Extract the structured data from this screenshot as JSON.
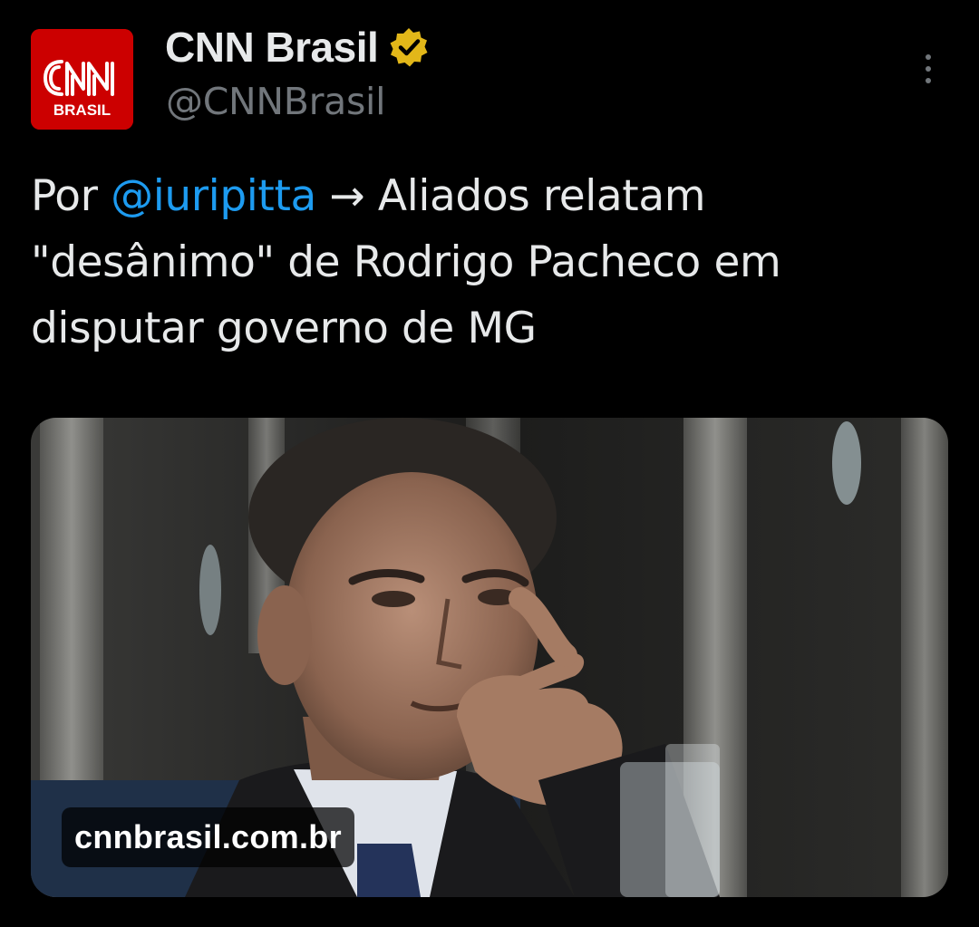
{
  "tweet": {
    "author": {
      "display_name": "CNN Brasil",
      "handle": "@CNNBrasil",
      "verified_icon": "verified-badge-gold",
      "avatar_text_top": "CNN",
      "avatar_text_bottom": "BRASIL",
      "avatar_color": "#cc0000"
    },
    "more_icon": "more-vertical-icon",
    "text": {
      "prefix": "Por ",
      "mention": "@iuripitta",
      "body": " → Aliados relatam \"desânimo\" de Rodrigo Pacheco em disputar governo de MG"
    },
    "card": {
      "domain": "cnnbrasil.com.br",
      "image": "photo-of-man-resting-chin-on-hand"
    }
  },
  "colors": {
    "background": "#000000",
    "text": "#e7e9ea",
    "secondary": "#71767b",
    "link": "#1d9bf0",
    "verified": "#e2b719"
  }
}
